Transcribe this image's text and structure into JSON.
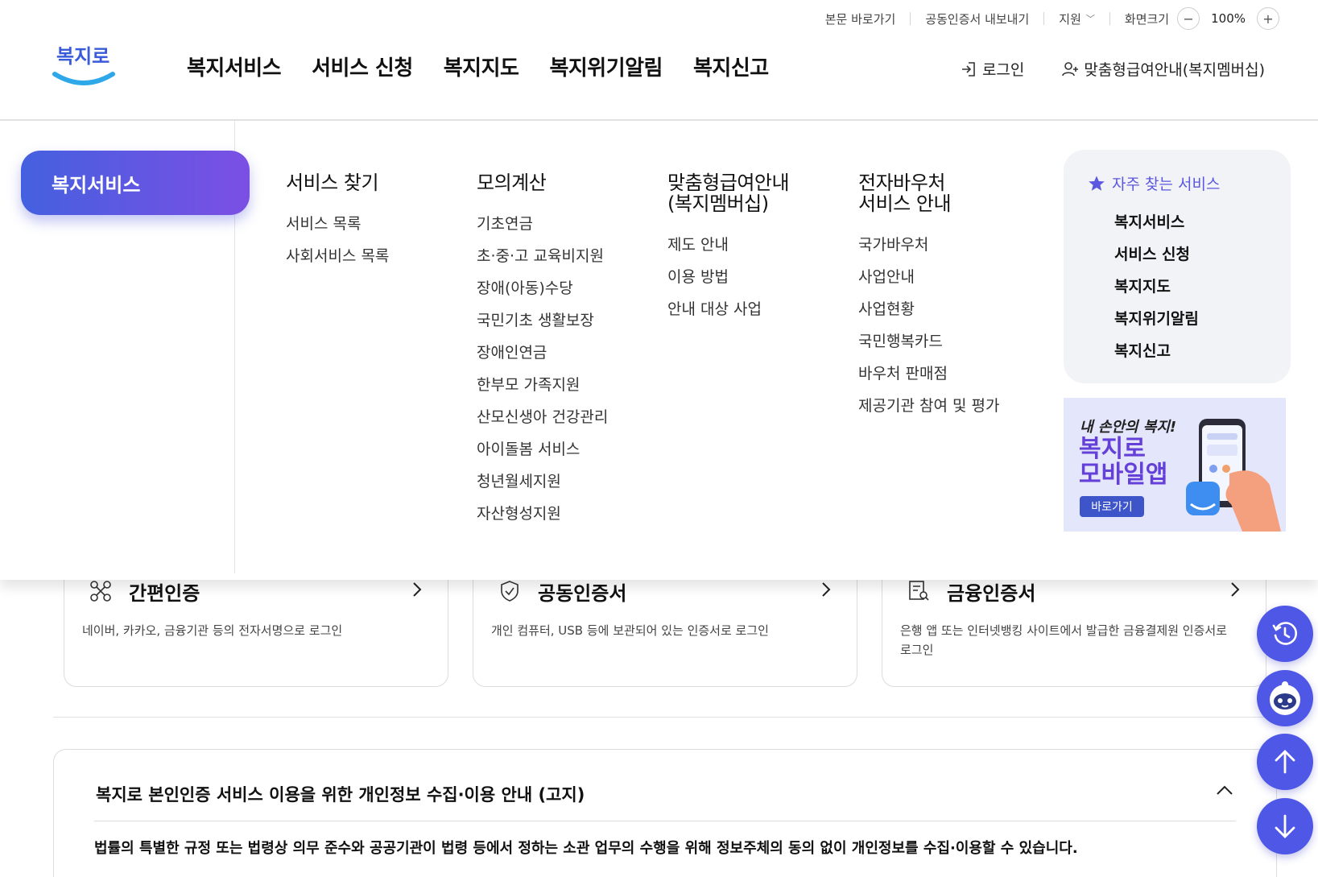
{
  "util": {
    "skip": "본문 바로가기",
    "cert_export": "공동인증서 내보내기",
    "support": "지원",
    "zoom_label": "화면크기",
    "zoom_value": "100%",
    "zoom_minus": "−",
    "zoom_plus": "+"
  },
  "logo": {
    "text": "복지로"
  },
  "gnb": [
    "복지서비스",
    "서비스 신청",
    "복지지도",
    "복지위기알림",
    "복지신고"
  ],
  "header_right": {
    "login": "로그인",
    "membership": "맞춤형급여안내(복지멤버십)"
  },
  "mega": {
    "active": "복지서비스",
    "columns": [
      {
        "title": "서비스 찾기",
        "items": [
          "서비스 목록",
          "사회서비스 목록"
        ]
      },
      {
        "title": "모의계산",
        "items": [
          "기초연금",
          "초·중·고 교육비지원",
          "장애(아동)수당",
          "국민기초 생활보장",
          "장애인연금",
          "한부모 가족지원",
          "산모신생아 건강관리",
          "아이돌봄 서비스",
          "청년월세지원",
          "자산형성지원"
        ]
      },
      {
        "title": "맞춤형급여안내\n(복지멤버십)",
        "items": [
          "제도 안내",
          "이용 방법",
          "안내 대상 사업"
        ]
      },
      {
        "title": "전자바우처\n서비스 안내",
        "items": [
          "국가바우처",
          "사업안내",
          "사업현황",
          "국민행복카드",
          "바우처 판매점",
          "제공기관 참여 및 평가"
        ]
      }
    ],
    "favorites": {
      "title": "자주 찾는 서비스",
      "items": [
        "복지서비스",
        "서비스 신청",
        "복지지도",
        "복지위기알림",
        "복지신고"
      ]
    },
    "banner": {
      "line1": "내 손안의 복지!",
      "line2": "복지로\n모바일앱",
      "button": "바로가기"
    }
  },
  "cards": [
    {
      "icon": "link-nodes-icon",
      "title": "간편인증",
      "desc": "네이버, 카카오, 금융기관 등의 전자서명으로 로그인"
    },
    {
      "icon": "shield-check-icon",
      "title": "공동인증서",
      "desc": "개인 컴퓨터, USB 등에 보관되어 있는 인증서로 로그인"
    },
    {
      "icon": "document-search-icon",
      "title": "금융인증서",
      "desc": "은행 앱 또는 인터넷뱅킹 사이트에서 발급한 금융결제원 인증서로 로그인"
    }
  ],
  "notice": {
    "title": "복지로 본인인증 서비스 이용을 위한 개인정보 수집·이용 안내 (고지)",
    "body": "법률의 특별한 규정 또는 법령상 의무 준수와 공공기관이 법령 등에서 정하는 소관 업무의 수행을 위해 정보주체의 동의 없이 개인정보를 수집·이용할 수 있습니다."
  },
  "colors": {
    "accent": "#4f57e6",
    "gradient_start": "#4460e0",
    "gradient_end": "#7c4fe4",
    "fav_title": "#5b57e0"
  }
}
